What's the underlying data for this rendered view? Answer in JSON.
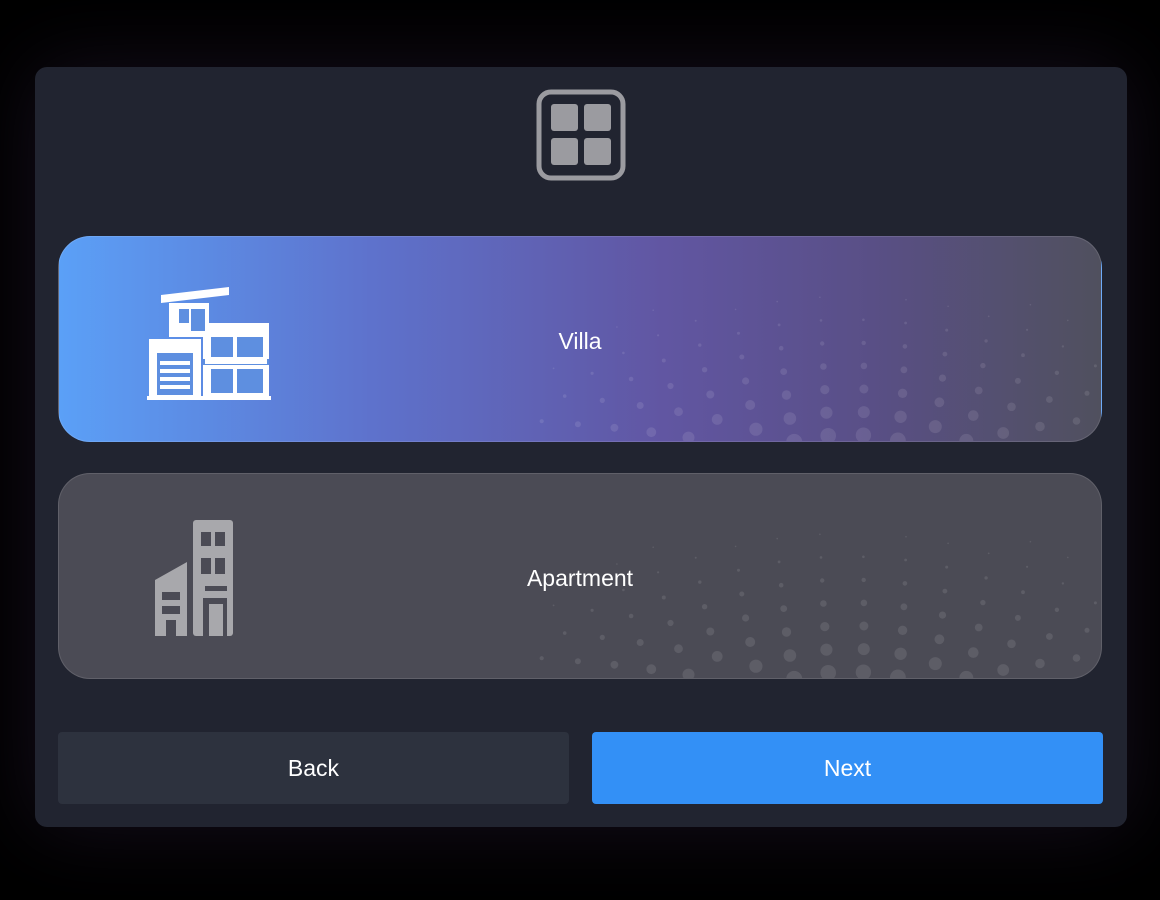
{
  "header": {
    "icon": "grid-icon"
  },
  "options": [
    {
      "label": "Villa",
      "icon": "villa-icon",
      "selected": true
    },
    {
      "label": "Apartment",
      "icon": "apartment-icon",
      "selected": false
    }
  ],
  "footer": {
    "back_label": "Back",
    "next_label": "Next"
  },
  "colors": {
    "panel": "#212430",
    "selected_start": "#5ba0f7",
    "selected_end": "#50505e",
    "unselected": "#4b4b55",
    "back_button": "#2d323e",
    "next_button": "#3390f6"
  }
}
